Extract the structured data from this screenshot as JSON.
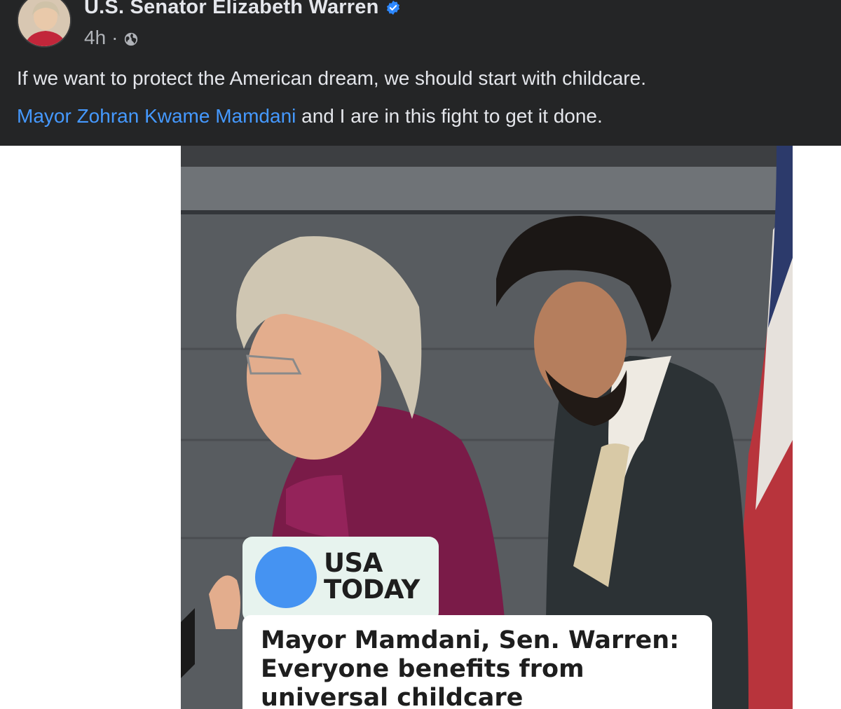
{
  "post": {
    "author": "U.S. Senator Elizabeth Warren",
    "time": "4h",
    "separator": "·",
    "line1": "If we want to protect the American dream, we should start with childcare.",
    "mention": "Mayor Zohran Kwame Mamdani",
    "line2_rest": " and I are in this fight to get it done."
  },
  "article": {
    "logo_line1": "USA",
    "logo_line2": "TODAY",
    "headline": "Mayor Mamdani, Sen. Warren: Everyone benefits from universal childcare"
  },
  "colors": {
    "header_bg": "#242526",
    "link": "#4599ff",
    "usa_today_dot": "#4593f2",
    "verified": "#2d88ff"
  },
  "icons": [
    "verified-badge-icon",
    "globe-icon"
  ]
}
